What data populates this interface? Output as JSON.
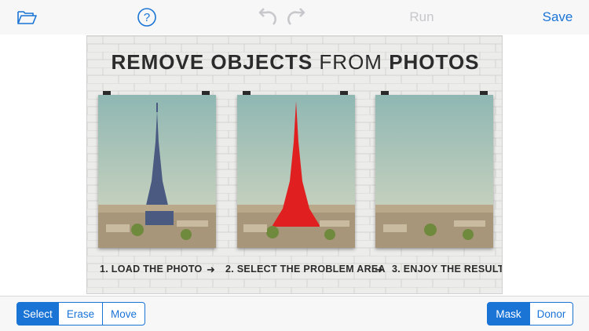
{
  "toolbar": {
    "open_icon": "folder-open-icon",
    "help_icon": "help-circle-icon",
    "undo_icon": "undo-icon",
    "redo_icon": "redo-icon",
    "run_label": "Run",
    "save_label": "Save"
  },
  "image": {
    "headline_bold_1": "REMOVE OBJECTS ",
    "headline_light": "FROM ",
    "headline_bold_2": "PHOTOS",
    "step1": "1. LOAD THE PHOTO",
    "step2": "2. SELECT THE PROBLEM AREA",
    "step3": "3. ENJOY THE RESULT"
  },
  "bottom": {
    "tools": [
      {
        "label": "Select",
        "active": true
      },
      {
        "label": "Erase",
        "active": false
      },
      {
        "label": "Move",
        "active": false
      }
    ],
    "modes": [
      {
        "label": "Mask",
        "active": true
      },
      {
        "label": "Donor",
        "active": false
      }
    ]
  },
  "colors": {
    "accent": "#1a74d6",
    "disabled": "#c8c8cc",
    "mask_red": "#e02020"
  }
}
